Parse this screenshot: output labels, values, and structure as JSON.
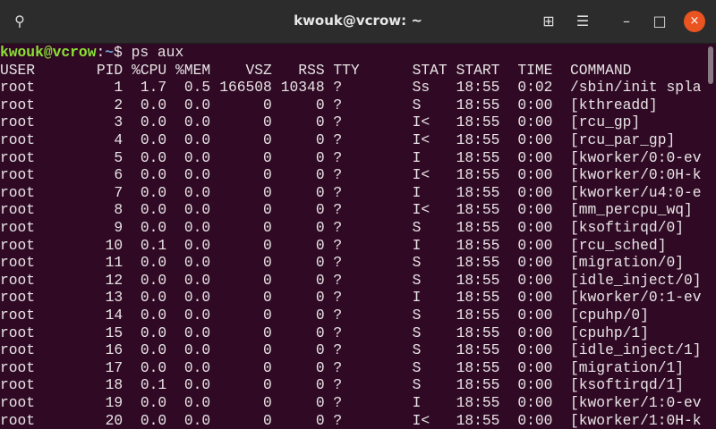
{
  "window": {
    "title": "kwouk@vcrow: ~",
    "close_label": "×",
    "minimize_label": "–",
    "maximize_label": "□",
    "menu_label": "☰",
    "newtab_label": "⊞",
    "search_label": "⚲"
  },
  "prompt": {
    "user_host": "kwouk@vcrow",
    "colon": ":",
    "path": "~",
    "symbol": "$",
    "command": " ps aux"
  },
  "header": {
    "user": "USER",
    "pid": "PID",
    "cpu": "%CPU",
    "mem": "%MEM",
    "vsz": "VSZ",
    "rss": "RSS",
    "tty": "TTY",
    "stat": "STAT",
    "start": "START",
    "time": "TIME",
    "command": "COMMAND"
  },
  "rows": [
    {
      "user": "root",
      "pid": "1",
      "cpu": "1.7",
      "mem": "0.5",
      "vsz": "166508",
      "rss": "10348",
      "tty": "?",
      "stat": "Ss",
      "start": "18:55",
      "time": "0:02",
      "command": "/sbin/init spla"
    },
    {
      "user": "root",
      "pid": "2",
      "cpu": "0.0",
      "mem": "0.0",
      "vsz": "0",
      "rss": "0",
      "tty": "?",
      "stat": "S",
      "start": "18:55",
      "time": "0:00",
      "command": "[kthreadd]"
    },
    {
      "user": "root",
      "pid": "3",
      "cpu": "0.0",
      "mem": "0.0",
      "vsz": "0",
      "rss": "0",
      "tty": "?",
      "stat": "I<",
      "start": "18:55",
      "time": "0:00",
      "command": "[rcu_gp]"
    },
    {
      "user": "root",
      "pid": "4",
      "cpu": "0.0",
      "mem": "0.0",
      "vsz": "0",
      "rss": "0",
      "tty": "?",
      "stat": "I<",
      "start": "18:55",
      "time": "0:00",
      "command": "[rcu_par_gp]"
    },
    {
      "user": "root",
      "pid": "5",
      "cpu": "0.0",
      "mem": "0.0",
      "vsz": "0",
      "rss": "0",
      "tty": "?",
      "stat": "I",
      "start": "18:55",
      "time": "0:00",
      "command": "[kworker/0:0-ev"
    },
    {
      "user": "root",
      "pid": "6",
      "cpu": "0.0",
      "mem": "0.0",
      "vsz": "0",
      "rss": "0",
      "tty": "?",
      "stat": "I<",
      "start": "18:55",
      "time": "0:00",
      "command": "[kworker/0:0H-k"
    },
    {
      "user": "root",
      "pid": "7",
      "cpu": "0.0",
      "mem": "0.0",
      "vsz": "0",
      "rss": "0",
      "tty": "?",
      "stat": "I",
      "start": "18:55",
      "time": "0:00",
      "command": "[kworker/u4:0-e"
    },
    {
      "user": "root",
      "pid": "8",
      "cpu": "0.0",
      "mem": "0.0",
      "vsz": "0",
      "rss": "0",
      "tty": "?",
      "stat": "I<",
      "start": "18:55",
      "time": "0:00",
      "command": "[mm_percpu_wq]"
    },
    {
      "user": "root",
      "pid": "9",
      "cpu": "0.0",
      "mem": "0.0",
      "vsz": "0",
      "rss": "0",
      "tty": "?",
      "stat": "S",
      "start": "18:55",
      "time": "0:00",
      "command": "[ksoftirqd/0]"
    },
    {
      "user": "root",
      "pid": "10",
      "cpu": "0.1",
      "mem": "0.0",
      "vsz": "0",
      "rss": "0",
      "tty": "?",
      "stat": "I",
      "start": "18:55",
      "time": "0:00",
      "command": "[rcu_sched]"
    },
    {
      "user": "root",
      "pid": "11",
      "cpu": "0.0",
      "mem": "0.0",
      "vsz": "0",
      "rss": "0",
      "tty": "?",
      "stat": "S",
      "start": "18:55",
      "time": "0:00",
      "command": "[migration/0]"
    },
    {
      "user": "root",
      "pid": "12",
      "cpu": "0.0",
      "mem": "0.0",
      "vsz": "0",
      "rss": "0",
      "tty": "?",
      "stat": "S",
      "start": "18:55",
      "time": "0:00",
      "command": "[idle_inject/0]"
    },
    {
      "user": "root",
      "pid": "13",
      "cpu": "0.0",
      "mem": "0.0",
      "vsz": "0",
      "rss": "0",
      "tty": "?",
      "stat": "I",
      "start": "18:55",
      "time": "0:00",
      "command": "[kworker/0:1-ev"
    },
    {
      "user": "root",
      "pid": "14",
      "cpu": "0.0",
      "mem": "0.0",
      "vsz": "0",
      "rss": "0",
      "tty": "?",
      "stat": "S",
      "start": "18:55",
      "time": "0:00",
      "command": "[cpuhp/0]"
    },
    {
      "user": "root",
      "pid": "15",
      "cpu": "0.0",
      "mem": "0.0",
      "vsz": "0",
      "rss": "0",
      "tty": "?",
      "stat": "S",
      "start": "18:55",
      "time": "0:00",
      "command": "[cpuhp/1]"
    },
    {
      "user": "root",
      "pid": "16",
      "cpu": "0.0",
      "mem": "0.0",
      "vsz": "0",
      "rss": "0",
      "tty": "?",
      "stat": "S",
      "start": "18:55",
      "time": "0:00",
      "command": "[idle_inject/1]"
    },
    {
      "user": "root",
      "pid": "17",
      "cpu": "0.0",
      "mem": "0.0",
      "vsz": "0",
      "rss": "0",
      "tty": "?",
      "stat": "S",
      "start": "18:55",
      "time": "0:00",
      "command": "[migration/1]"
    },
    {
      "user": "root",
      "pid": "18",
      "cpu": "0.1",
      "mem": "0.0",
      "vsz": "0",
      "rss": "0",
      "tty": "?",
      "stat": "S",
      "start": "18:55",
      "time": "0:00",
      "command": "[ksoftirqd/1]"
    },
    {
      "user": "root",
      "pid": "19",
      "cpu": "0.0",
      "mem": "0.0",
      "vsz": "0",
      "rss": "0",
      "tty": "?",
      "stat": "I",
      "start": "18:55",
      "time": "0:00",
      "command": "[kworker/1:0-ev"
    },
    {
      "user": "root",
      "pid": "20",
      "cpu": "0.0",
      "mem": "0.0",
      "vsz": "0",
      "rss": "0",
      "tty": "?",
      "stat": "I<",
      "start": "18:55",
      "time": "0:00",
      "command": "[kworker/1:0H-k"
    }
  ]
}
